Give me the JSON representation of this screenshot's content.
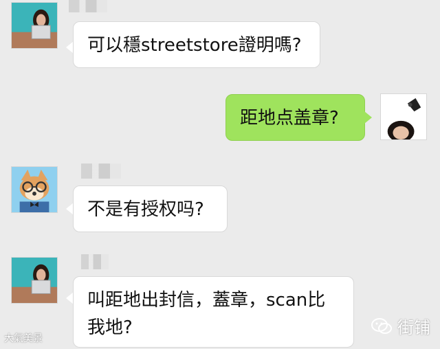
{
  "messages": [
    {
      "id": "m1",
      "side": "in",
      "avatar": "girl-ipad-avatar",
      "text": "可以穩streetstore證明嗎?"
    },
    {
      "id": "m2",
      "side": "out",
      "avatar": "girl-bird-avatar",
      "text": "距地点盖章?"
    },
    {
      "id": "m3",
      "side": "in",
      "avatar": "shiba-glasses-avatar",
      "text": "不是有授权吗?"
    },
    {
      "id": "m4",
      "side": "in",
      "avatar": "girl-ipad-avatar",
      "text": "叫距地出封信，蓋章，scan比我地?"
    }
  ],
  "watermark": {
    "label": "街铺",
    "icon": "wechat-icon"
  },
  "watermark_left": {
    "label": "大氣美景"
  },
  "colors": {
    "background": "#ebebeb",
    "incoming": "#ffffff",
    "outgoing": "#9fe35d"
  }
}
